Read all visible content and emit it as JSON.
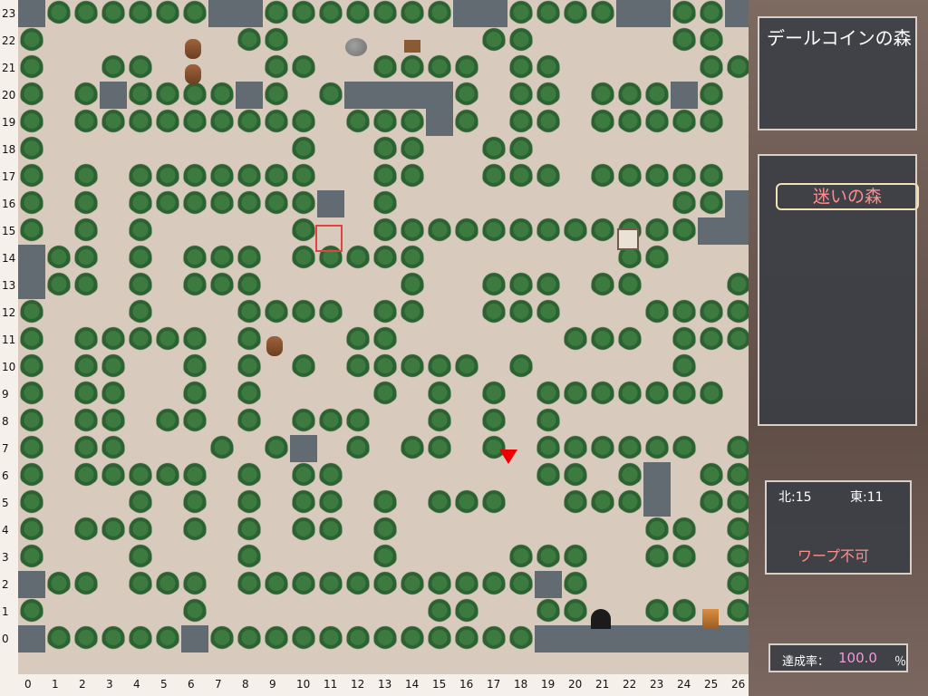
{
  "right_panel": {
    "area_name": "デールコインの森",
    "forest_tag": "迷いの森",
    "coords": {
      "north_label": "北",
      "north_value": "15",
      "east_label": "東",
      "east_value": "11"
    },
    "warp_status": "ワープ不可",
    "achievement": {
      "label": "達成率：",
      "value": "100.0",
      "suffix": "％"
    }
  },
  "axes": {
    "y_labels": [
      "23",
      "22",
      "21",
      "20",
      "19",
      "18",
      "17",
      "16",
      "15",
      "14",
      "13",
      "12",
      "11",
      "10",
      "9",
      "8",
      "7",
      "6",
      "5",
      "4",
      "3",
      "2",
      "1",
      "0"
    ],
    "x_labels": [
      "0",
      "1",
      "2",
      "3",
      "4",
      "5",
      "6",
      "7",
      "8",
      "9",
      "10",
      "11",
      "12",
      "13",
      "14",
      "15",
      "16",
      "17",
      "18",
      "19",
      "20",
      "21",
      "22",
      "23",
      "24",
      "25",
      "26"
    ]
  },
  "map": {
    "rows": [
      "WTTTTTTWWTTTTTTTWWTTTTWWTTW",
      "T.....B.TT...R.S.TT.....TT.T",
      "T..TT...BTT..TTTT.TT.....TT.T",
      "T.TWTTTTWT.TWWWWT.TT.TTTWT.TW",
      "T.TTTTTTTTT.TTTWT.TT.TTTTT.TW",
      "T.........T..TT..TT.........T",
      "T.T.TTTTTTT..TT..TTT.TTTTT..T",
      "T.T.TTTTTTTW.T..........TTWWT",
      "T.T.T.....TR.TTTTTTTTTTTTWWWT",
      "WTT.T.TTT.TTTTT.......TT....T",
      "WTT.T.TTT.....T..TTT.TT...T.T",
      "T...T...TTTT.TT..TTT...TTTT.T",
      "T.TTTTT.T.B.TT......TTT.TTTT.T",
      "T.TT..T.T.T.TTTTT.T.....T..T",
      "T.TT..T.T....T.T.T.TTTTTTT.T",
      "T.TT.TT.T.TTT..T.T.T.......T",
      "T.TT...T.TW.T.TT.T.TTTTTT.T",
      "T.TTTTT.T.TT.......TT.TW.TT",
      "T...T.T.T.TT.T.TTT..TTTW.TT",
      "T.TTT.T.T.TT.T.........TT.T",
      "T...T...T....T....TTT..TT.T",
      "WTT.TTT.TTTTTTTTTTTWT.....TT",
      "T.....T........TT..TT..TT.T",
      "WTTTTTWTTTTTTTTTTTTWWWWWWWW"
    ],
    "legend": {
      "T": "tree",
      "W": "wall",
      ".": "path",
      "B": "barrel",
      "R": "rock",
      "S": "signpost"
    }
  }
}
